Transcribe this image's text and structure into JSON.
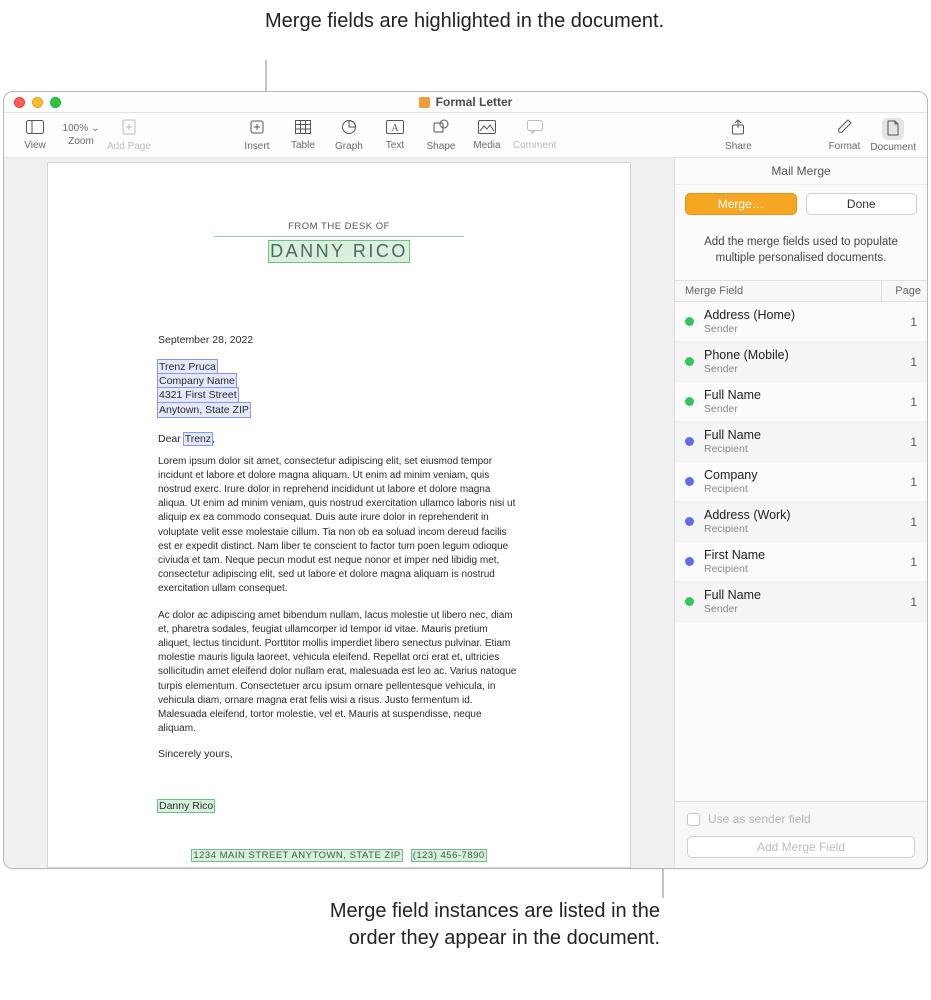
{
  "callouts": {
    "top": "Merge fields are highlighted in the document.",
    "bottom": "Merge field instances are listed in the order they appear in the document."
  },
  "window": {
    "title": "Formal Letter"
  },
  "toolbar": {
    "view": "View",
    "zoom_value": "100%",
    "zoom_label": "Zoom",
    "add_page": "Add Page",
    "insert": "Insert",
    "table": "Table",
    "graph": "Graph",
    "text": "Text",
    "shape": "Shape",
    "media": "Media",
    "comment": "Comment",
    "share": "Share",
    "format": "Format",
    "document": "Document"
  },
  "document": {
    "desk_of": "FROM THE DESK OF",
    "name": "DANNY RICO",
    "date": "September 28, 2022",
    "addr": {
      "line1": "Trenz Pruca",
      "line2": "Company Name",
      "line3": "4321 First Street",
      "line4": "Anytown, State ZIP"
    },
    "salute_pre": "Dear ",
    "salute_name": "Trenz",
    "salute_post": ",",
    "para1": "Lorem ipsum dolor sit amet, consectetur adipiscing elit, set eiusmod tempor incidunt et labore et dolore magna aliquam. Ut enim ad minim veniam, quis nostrud exerc. Irure dolor in reprehend incididunt ut labore et dolore magna aliqua. Ut enim ad minim veniam, quis nostrud exercitation ullamco laboris nisi ut aliquip ex ea commodo consequat. Duis aute irure dolor in reprehenderit in voluptate velit esse molestaie cillum. Tia non ob ea soluad incom dereud facilis est er expedit distinct. Nam liber te conscient to factor tum poen legum odioque civiuda et tam. Neque pecun modut est neque nonor et imper ned libidig met, consectetur adipiscing elit, sed ut labore et dolore magna aliquam is nostrud exercitation ullam consequet.",
    "para2": "Ac dolor ac adipiscing amet bibendum nullam, lacus molestie ut libero nec, diam et, pharetra sodales, feugiat ullamcorper id tempor id vitae. Mauris pretium aliquet, lectus tincidunt. Porttitor mollis imperdiet libero senectus pulvinar. Etiam molestie mauris ligula laoreet, vehicula eleifend. Repellat orci erat et, ultricies sollicitudin amet eleifend dolor nullam erat, malesuada est leo ac. Varius natoque turpis elementum. Consectetuer arcu ipsum ornare pellentesque vehicula, in vehicula diam, ornare magna erat felis wisi a risus. Justo fermentum id. Malesuada eleifend, tortor molestie, vel et. Mauris at suspendisse, neque aliquam.",
    "closing": "Sincerely yours,",
    "signature": "Danny Rico",
    "footer_addr": "1234 MAIN STREET   ANYTOWN, STATE ZIP",
    "footer_phone": "(123) 456-7890"
  },
  "sidebar": {
    "title": "Mail Merge",
    "merge_btn": "Merge…",
    "done_btn": "Done",
    "help": "Add the merge fields used to populate multiple personalised documents.",
    "col_field": "Merge Field",
    "col_page": "Page",
    "rows": [
      {
        "color": "g",
        "name": "Address (Home)",
        "role": "Sender",
        "page": "1"
      },
      {
        "color": "g",
        "name": "Phone (Mobile)",
        "role": "Sender",
        "page": "1"
      },
      {
        "color": "g",
        "name": "Full Name",
        "role": "Sender",
        "page": "1"
      },
      {
        "color": "b",
        "name": "Full Name",
        "role": "Recipient",
        "page": "1"
      },
      {
        "color": "b",
        "name": "Company",
        "role": "Recipient",
        "page": "1"
      },
      {
        "color": "b",
        "name": "Address (Work)",
        "role": "Recipient",
        "page": "1"
      },
      {
        "color": "b",
        "name": "First Name",
        "role": "Recipient",
        "page": "1"
      },
      {
        "color": "g",
        "name": "Full Name",
        "role": "Sender",
        "page": "1"
      }
    ],
    "use_as_sender": "Use as sender field",
    "add_field": "Add Merge Field"
  }
}
